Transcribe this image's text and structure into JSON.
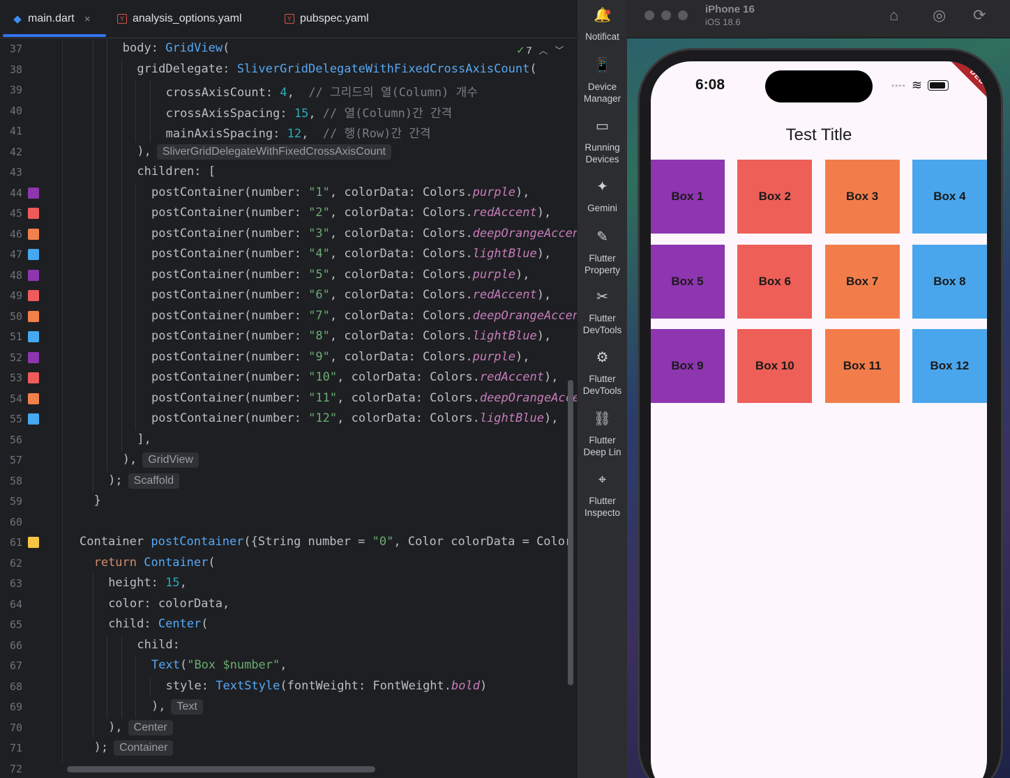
{
  "tabs": [
    {
      "label": "main.dart",
      "icon": "dart-icon",
      "active": true
    },
    {
      "label": "analysis_options.yaml",
      "icon": "yaml-icon",
      "active": false
    },
    {
      "label": "pubspec.yaml",
      "icon": "yaml-icon",
      "active": false
    }
  ],
  "tab_close_glyph": "×",
  "inspection": {
    "count": "7"
  },
  "code_lines": [
    {
      "n": "37",
      "indent": 2,
      "html": "body: <span class='ty'>GridView</span>("
    },
    {
      "n": "38",
      "indent": 3,
      "html": "gridDelegate: <span class='ty'>SliverGridDelegateWithFixedCrossAxisCount</span>("
    },
    {
      "n": "39",
      "indent": 5,
      "html": "crossAxisCount: <span class='nm'>4</span>,  <span class='cm'>// 그리드의 열(Column) 개수</span>"
    },
    {
      "n": "40",
      "indent": 5,
      "html": "crossAxisSpacing: <span class='nm'>15</span>, <span class='cm'>// 열(Column)간 간격</span>"
    },
    {
      "n": "41",
      "indent": 5,
      "html": "mainAxisSpacing: <span class='nm'>12</span>,  <span class='cm'>// 행(Row)간 간격</span>"
    },
    {
      "n": "42",
      "indent": 3,
      "html": "),",
      "hint": "SliverGridDelegateWithFixedCrossAxisCount"
    },
    {
      "n": "43",
      "indent": 3,
      "html": "children: ["
    },
    {
      "n": "44",
      "indent": 4,
      "swatch": "#8e35b0",
      "html": "postContainer(number: <span class='st'>\"1\"</span>, colorData: Colors.<span class='it'>purple</span>),"
    },
    {
      "n": "45",
      "indent": 4,
      "swatch": "#ef5b5b",
      "html": "postContainer(number: <span class='st'>\"2\"</span>, colorData: Colors.<span class='it'>redAccent</span>),"
    },
    {
      "n": "46",
      "indent": 4,
      "swatch": "#f2804a",
      "html": "postContainer(number: <span class='st'>\"3\"</span>, colorData: Colors.<span class='it'>deepOrangeAccent</span>"
    },
    {
      "n": "47",
      "indent": 4,
      "swatch": "#45a8f0",
      "html": "postContainer(number: <span class='st'>\"4\"</span>, colorData: Colors.<span class='it'>lightBlue</span>),"
    },
    {
      "n": "48",
      "indent": 4,
      "swatch": "#8e35b0",
      "html": "postContainer(number: <span class='st'>\"5\"</span>, colorData: Colors.<span class='it'>purple</span>),"
    },
    {
      "n": "49",
      "indent": 4,
      "swatch": "#ef5b5b",
      "html": "postContainer(number: <span class='st'>\"6\"</span>, colorData: Colors.<span class='it'>redAccent</span>),"
    },
    {
      "n": "50",
      "indent": 4,
      "swatch": "#f2804a",
      "html": "postContainer(number: <span class='st'>\"7\"</span>, colorData: Colors.<span class='it'>deepOrangeAccent</span>"
    },
    {
      "n": "51",
      "indent": 4,
      "swatch": "#45a8f0",
      "html": "postContainer(number: <span class='st'>\"8\"</span>, colorData: Colors.<span class='it'>lightBlue</span>),"
    },
    {
      "n": "52",
      "indent": 4,
      "swatch": "#8e35b0",
      "html": "postContainer(number: <span class='st'>\"9\"</span>, colorData: Colors.<span class='it'>purple</span>),"
    },
    {
      "n": "53",
      "indent": 4,
      "swatch": "#ef5b5b",
      "html": "postContainer(number: <span class='st'>\"10\"</span>, colorData: Colors.<span class='it'>redAccent</span>),"
    },
    {
      "n": "54",
      "indent": 4,
      "swatch": "#f2804a",
      "html": "postContainer(number: <span class='st'>\"11\"</span>, colorData: Colors.<span class='it'>deepOrangeAccen</span>"
    },
    {
      "n": "55",
      "indent": 4,
      "swatch": "#45a8f0",
      "html": "postContainer(number: <span class='st'>\"12\"</span>, colorData: Colors.<span class='it'>lightBlue</span>),"
    },
    {
      "n": "56",
      "indent": 3,
      "html": "],"
    },
    {
      "n": "57",
      "indent": 2,
      "html": "),",
      "hint": "GridView"
    },
    {
      "n": "58",
      "indent": 1,
      "html": ");",
      "hint": "Scaffold"
    },
    {
      "n": "59",
      "indent": 0,
      "html": "}"
    },
    {
      "n": "60",
      "indent": 0,
      "html": ""
    },
    {
      "n": "61",
      "indent": -1,
      "swatch": "#f6c544",
      "html": "Container <span class='ty'>postContainer</span>({String number = <span class='st'>\"0\"</span>, Color colorData = Color"
    },
    {
      "n": "62",
      "indent": 0,
      "html": "<span class='kw'>return</span> <span class='ty'>Container</span>("
    },
    {
      "n": "63",
      "indent": 1,
      "html": "height: <span class='nm'>15</span>,"
    },
    {
      "n": "64",
      "indent": 1,
      "html": "color: colorData,"
    },
    {
      "n": "65",
      "indent": 1,
      "html": "child: <span class='ty'>Center</span>("
    },
    {
      "n": "66",
      "indent": 3,
      "html": "child:"
    },
    {
      "n": "67",
      "indent": 4,
      "html": "<span class='ty'>Text</span>(<span class='st'>\"Box $number\"</span>,"
    },
    {
      "n": "68",
      "indent": 5,
      "html": "style: <span class='ty'>TextStyle</span>(fontWeight: FontWeight.<span class='it'>bold</span>)"
    },
    {
      "n": "69",
      "indent": 4,
      "html": "),",
      "hint": "Text"
    },
    {
      "n": "70",
      "indent": 1,
      "html": "),",
      "hint": "Center"
    },
    {
      "n": "71",
      "indent": 0,
      "html": ");",
      "hint": "Container"
    },
    {
      "n": "72",
      "indent": 0,
      "html": ""
    }
  ],
  "tools": [
    {
      "name": "notifications",
      "icon": "bell-icon",
      "glyph": "🔔",
      "label": "Notificat",
      "badge": true
    },
    {
      "name": "device-manager",
      "icon": "device-manager-icon",
      "glyph": "📱",
      "label": "Device\nManager"
    },
    {
      "name": "running-devices",
      "icon": "running-devices-icon",
      "glyph": "▭",
      "label": "Running\nDevices"
    },
    {
      "name": "gemini",
      "icon": "gemini-icon",
      "glyph": "✦",
      "label": "Gemini"
    },
    {
      "name": "flutter-property",
      "icon": "pencil-icon",
      "glyph": "✎",
      "label": "Flutter\nProperty"
    },
    {
      "name": "flutter-devtools-1",
      "icon": "devtools-icon",
      "glyph": "✂",
      "label": "Flutter\nDevTools"
    },
    {
      "name": "flutter-devtools-2",
      "icon": "devtools-puzzle-icon",
      "glyph": "⚙",
      "label": "Flutter\nDevTools"
    },
    {
      "name": "flutter-deep-links",
      "icon": "link-icon",
      "glyph": "⛓",
      "label": "Flutter\nDeep Lin"
    },
    {
      "name": "flutter-inspector",
      "icon": "inspector-icon",
      "glyph": "⌖",
      "label": "Flutter\nInspecto"
    }
  ],
  "simulator": {
    "device_name": "iPhone 16",
    "os": "iOS 18.6",
    "home_glyph": "⌂",
    "screenshot_glyph": "◎",
    "rotate_glyph": "⟳"
  },
  "phone": {
    "time": "6:08",
    "cellular": "••••",
    "wifi": "≋",
    "debug_banner": "DEBUG",
    "app_title": "Test Title",
    "boxes": [
      {
        "label": "Box 1",
        "color": "#8e35b0"
      },
      {
        "label": "Box 2",
        "color": "#ed5f57"
      },
      {
        "label": "Box 3",
        "color": "#f27d4a"
      },
      {
        "label": "Box 4",
        "color": "#4aa6ec"
      },
      {
        "label": "Box 5",
        "color": "#8e35b0"
      },
      {
        "label": "Box 6",
        "color": "#ed5f57"
      },
      {
        "label": "Box 7",
        "color": "#f27d4a"
      },
      {
        "label": "Box 8",
        "color": "#4aa6ec"
      },
      {
        "label": "Box 9",
        "color": "#8e35b0"
      },
      {
        "label": "Box 10",
        "color": "#ed5f57"
      },
      {
        "label": "Box 11",
        "color": "#f27d4a"
      },
      {
        "label": "Box 12",
        "color": "#4aa6ec"
      }
    ]
  }
}
